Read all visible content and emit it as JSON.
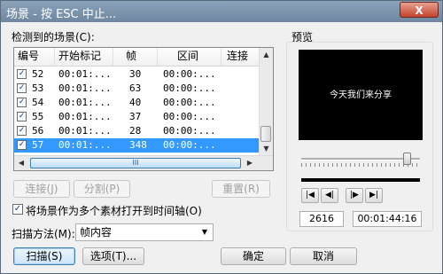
{
  "window": {
    "title": "场景 - 按 ESC 中止...",
    "close_glyph": "X"
  },
  "detected_label": "检测到的场景(C):",
  "columns": [
    "编号",
    "开始标记",
    "帧",
    "区间",
    "连接"
  ],
  "rows": [
    {
      "checked": true,
      "num": "52",
      "start": "00:01:...",
      "frame": "30",
      "range": "00:00:...",
      "selected": false
    },
    {
      "checked": true,
      "num": "53",
      "start": "00:01:...",
      "frame": "63",
      "range": "00:00:...",
      "selected": false
    },
    {
      "checked": true,
      "num": "54",
      "start": "00:01:...",
      "frame": "40",
      "range": "00:00:...",
      "selected": false
    },
    {
      "checked": true,
      "num": "55",
      "start": "00:01:...",
      "frame": "37",
      "range": "00:00:...",
      "selected": false
    },
    {
      "checked": true,
      "num": "56",
      "start": "00:01:...",
      "frame": "28",
      "range": "00:00:...",
      "selected": false
    },
    {
      "checked": true,
      "num": "57",
      "start": "00:01:...",
      "frame": "348",
      "range": "00:00:...",
      "selected": true
    }
  ],
  "scrollbar": {
    "thumb_glyph": "III"
  },
  "buttons": {
    "join": "连接(J)",
    "split": "分割(P)",
    "reset": "重置(R)",
    "scan": "扫描(S)",
    "options": "选项(T)...",
    "ok": "确定",
    "cancel": "取消"
  },
  "multi_clip": {
    "checked": true,
    "label": "将场景作为多个素材打开到时间轴(O)"
  },
  "scan_method": {
    "label": "扫描方法(M):",
    "value": "帧内容"
  },
  "preview": {
    "label": "预览",
    "overlay_text": "今天我们来分享",
    "frame": "2616",
    "timecode": "00:01:44:16",
    "slider_position": 0.89
  },
  "transport_icons": [
    "skip-to-start-icon",
    "step-back-icon",
    "step-forward-icon",
    "skip-to-end-icon"
  ],
  "colors": {
    "selection": "#3399ff",
    "titlebar": "#7a92aa"
  }
}
